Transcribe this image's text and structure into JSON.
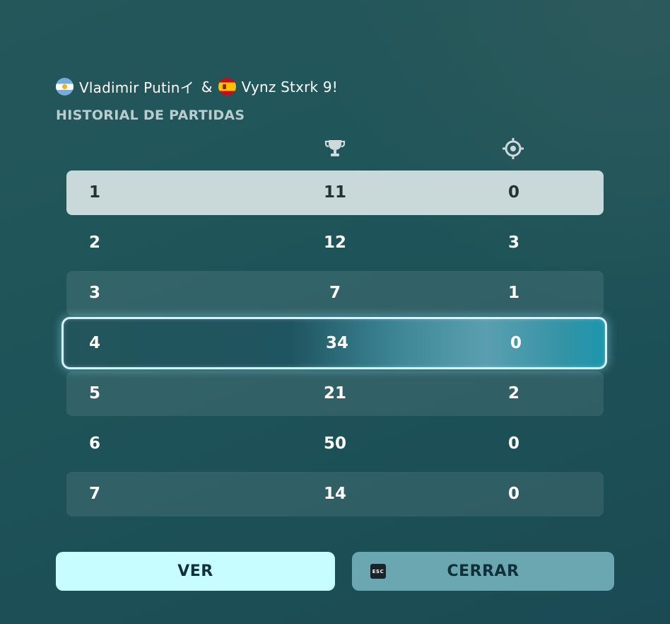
{
  "header": {
    "player1": {
      "name": "Vladimir Putinイ",
      "flag": "argentina-flag"
    },
    "separator": "&",
    "player2": {
      "name": "Vynz Stxrk 9!",
      "flag": "spain-flag"
    },
    "subtitle": "HISTORIAL DE PARTIDAS"
  },
  "columns": {
    "score_icon": "trophy-icon",
    "kills_icon": "crosshair-icon"
  },
  "rows": [
    {
      "num": "1",
      "score": "11",
      "kills": "0"
    },
    {
      "num": "2",
      "score": "12",
      "kills": "3"
    },
    {
      "num": "3",
      "score": "7",
      "kills": "1"
    },
    {
      "num": "4",
      "score": "34",
      "kills": "0"
    },
    {
      "num": "5",
      "score": "21",
      "kills": "2"
    },
    {
      "num": "6",
      "score": "50",
      "kills": "0"
    },
    {
      "num": "7",
      "score": "14",
      "kills": "0"
    }
  ],
  "selected_row": 4,
  "buttons": {
    "view_label": "VER",
    "close_label": "CERRAR",
    "close_key": "ESC"
  },
  "colors": {
    "accent": "#c8fdff",
    "selected_border": "#d4f4fb",
    "first_row": "#c9d9da"
  }
}
